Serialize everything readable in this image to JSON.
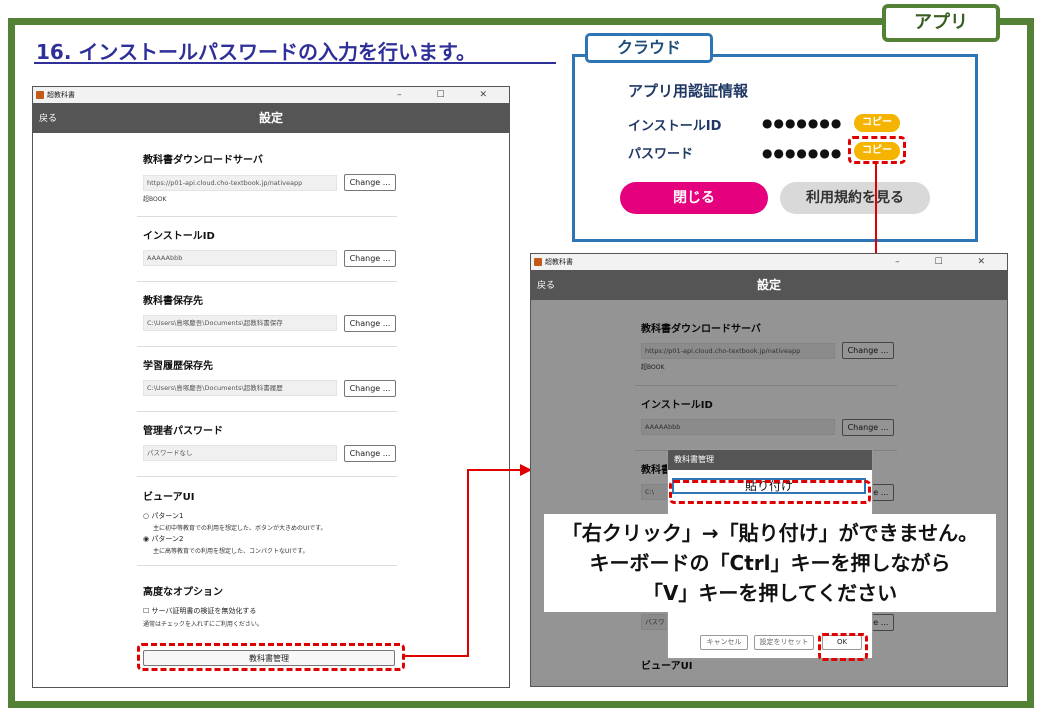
{
  "app_tab": "アプリ",
  "heading": "16. インストールパスワードの入力を行います。",
  "cloud": {
    "tab": "クラウド",
    "title": "アプリ用認証情報",
    "install_id_label": "インストールID",
    "install_id_value": "●●●●●●●",
    "password_label": "パスワード",
    "password_value": "●●●●●●●",
    "copy_label": "コピー",
    "close_label": "閉じる",
    "terms_label": "利用規約を見る"
  },
  "settings_window": {
    "app_name": "超教科書",
    "window_controls": "–  ☐  ✕",
    "back_label": "戻る",
    "title": "設定",
    "change_label": "Change ...",
    "download_server_title": "教科書ダウンロードサーバ",
    "download_server_url": "https://p01-api.cloud.cho-textbook.jp/nativeapp",
    "logo_text": "超BOOK",
    "install_id_title": "インストールID",
    "install_id_value": "AAAAAbbb",
    "save_dir_title": "教科書保存先",
    "save_dir_value": "C:\\Users\\島塚慶吾\\Documents\\超教科書保存",
    "history_dir_title": "学習履歴保存先",
    "history_dir_value": "C:\\Users\\島塚慶吾\\Documents\\超教科書履歴",
    "admin_pw_title": "管理者パスワード",
    "admin_pw_placeholder": "パスワードなし",
    "viewer_title": "ビューアUI",
    "pattern1_label": "○ パターン1",
    "pattern1_desc": "主に初中等教育での利用を想定した、ボタンが大きめのUIです。",
    "pattern2_label": "◉ パターン2",
    "pattern2_desc": "主に高等教育での利用を想定した、コンパクトなUIです。",
    "advanced_title": "高度なオプション",
    "cert_label": "☐ サーバ証明書の検証を無効化する",
    "cert_desc": "通常はチェックを入れずにご利用ください。",
    "manage_button": "教科書管理"
  },
  "dialog": {
    "title": "教科書管理",
    "paste_label": "貼り付け",
    "cancel_label": "キャンセル",
    "settings_label": "設定をリセット",
    "ok_label": "OK",
    "partial_field": "パスワ",
    "partial_c": "C:\\"
  },
  "message": {
    "line1": "「右クリック」→「貼り付け」ができません。",
    "line2": "キーボードの「Ctrl」キーを押しながら",
    "line3": "「V」キーを押してください"
  },
  "colors": {
    "frame": "#538135",
    "heading": "#2f2f9a",
    "cloud_border": "#2e75b6",
    "highlight": "#e00000",
    "copy_badge": "#f4b400",
    "close_button": "#e5007e"
  }
}
